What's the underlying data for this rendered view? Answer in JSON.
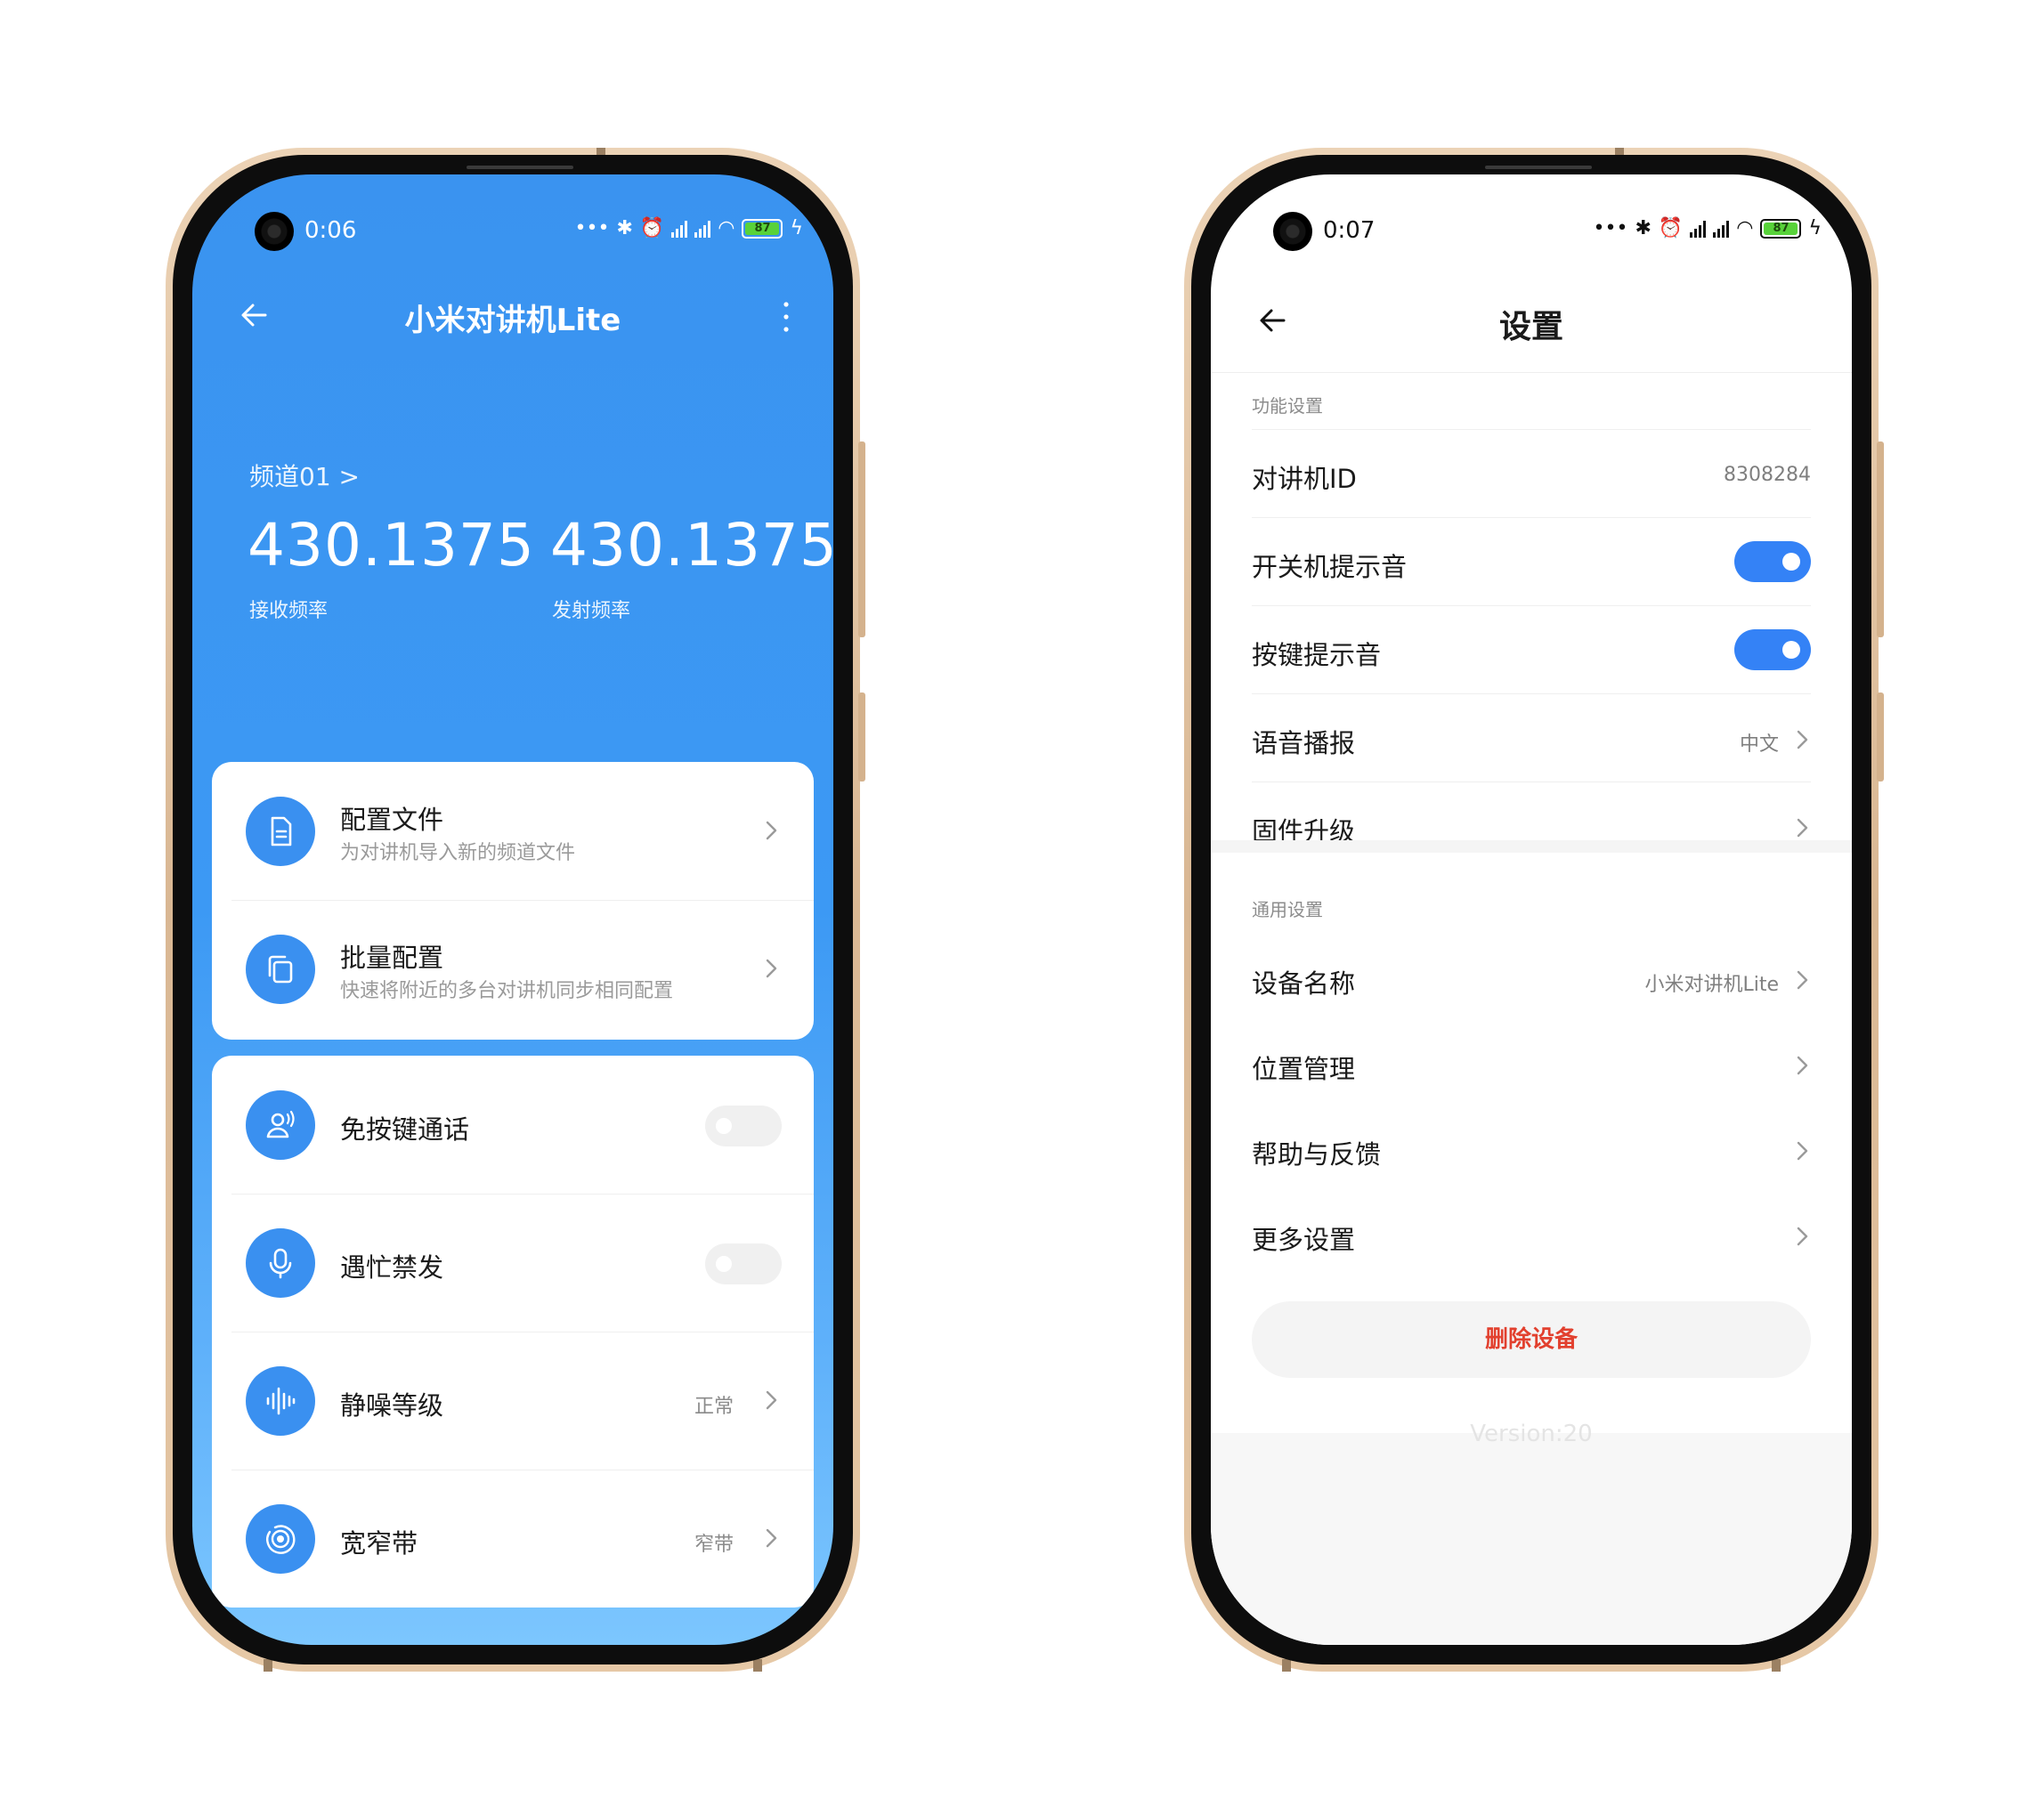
{
  "left_phone": {
    "status": {
      "time": "0:06",
      "dots": "•••",
      "battery": "87"
    },
    "nav": {
      "title": "小米对讲机Lite"
    },
    "channel": "频道01 >",
    "rx": {
      "value": "430.1375",
      "label": "接收频率"
    },
    "tx": {
      "value": "430.1375",
      "label": "发射频率"
    },
    "card1": [
      {
        "title": "配置文件",
        "subtitle": "为对讲机导入新的频道文件",
        "icon": "document-icon"
      },
      {
        "title": "批量配置",
        "subtitle": "快速将附近的多台对讲机同步相同配置",
        "icon": "copy-icon"
      }
    ],
    "card2": [
      {
        "title": "免按键通话",
        "icon": "voice-person-icon",
        "toggle": false
      },
      {
        "title": "遇忙禁发",
        "icon": "microphone-icon",
        "toggle": false
      },
      {
        "title": "静噪等级",
        "value": "正常",
        "icon": "waveform-icon"
      },
      {
        "title": "宽窄带",
        "value": "窄带",
        "icon": "signal-rings-icon"
      }
    ]
  },
  "right_phone": {
    "status": {
      "time": "0:07",
      "dots": "•••",
      "battery": "87"
    },
    "title": "设置",
    "section1": {
      "label": "功能设置",
      "rows": [
        {
          "label": "对讲机ID",
          "value": "8308284"
        },
        {
          "label": "开关机提示音",
          "toggle": true
        },
        {
          "label": "按键提示音",
          "toggle": true
        },
        {
          "label": "语音播报",
          "value": "中文"
        },
        {
          "label": "固件升级"
        }
      ]
    },
    "section2": {
      "label": "通用设置",
      "rows": [
        {
          "label": "设备名称",
          "value": "小米对讲机Lite"
        },
        {
          "label": "位置管理"
        },
        {
          "label": "帮助与反馈"
        },
        {
          "label": "更多设置"
        }
      ]
    },
    "delete_label": "删除设备",
    "version": "Version:20"
  },
  "colors": {
    "primary_blue": "#3a90f0",
    "toggle_on": "#3482f6",
    "danger_red": "#e2402e",
    "frame_gold": "#d9b793"
  }
}
